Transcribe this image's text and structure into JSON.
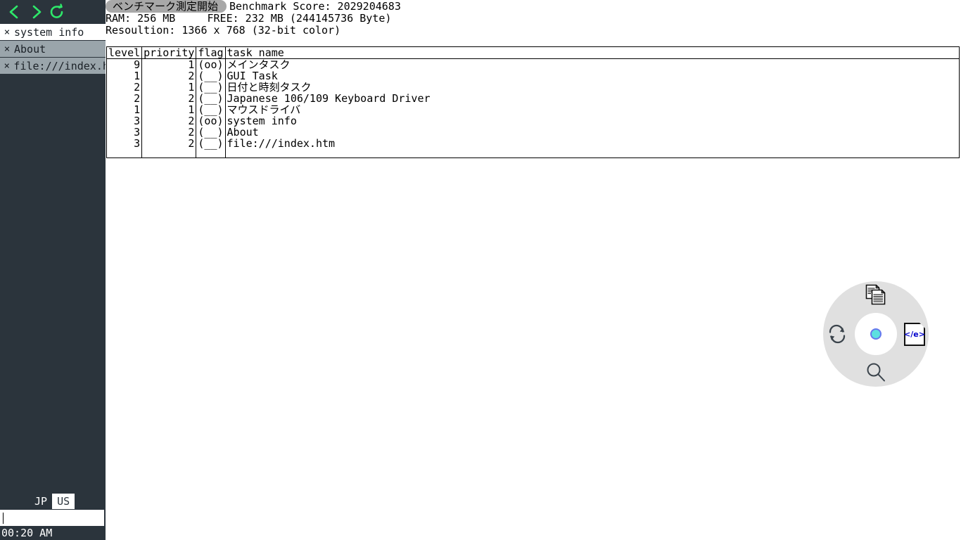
{
  "sidebar": {
    "nav": [
      {
        "name": "back-icon",
        "label": "<"
      },
      {
        "name": "forward-icon",
        "label": ">"
      },
      {
        "name": "reload-icon",
        "label": "↺"
      }
    ],
    "tasks": [
      {
        "close": "×",
        "label": "system info",
        "active": true
      },
      {
        "close": "×",
        "label": "About",
        "active": false
      },
      {
        "close": "×",
        "label": "file:///index.h",
        "active": false
      }
    ],
    "keyboard": {
      "options": [
        "JP",
        "US"
      ],
      "selected": "JP"
    },
    "command_input": {
      "value": "",
      "placeholder": ""
    },
    "clock": "00:20 AM"
  },
  "sysinfo": {
    "benchmark_button": "ベンチマーク測定開始",
    "benchmark_score": "Benchmark Score: 2029204683",
    "memory_line": "RAM: 256 MB     FREE: 232 MB (244145736 Byte)",
    "resolution_line": "Resoultion: 1366 x 768 (32-bit color)",
    "table": {
      "headers": [
        "level",
        "priority",
        "flag",
        "task name"
      ],
      "rows": [
        {
          "level": "9",
          "priority": "1",
          "flag": "(oo)",
          "name": "メインタスク"
        },
        {
          "level": "1",
          "priority": "2",
          "flag": "(__)",
          "name": "GUI Task"
        },
        {
          "level": "2",
          "priority": "1",
          "flag": "(__)",
          "name": "日付と時刻タスク"
        },
        {
          "level": "2",
          "priority": "2",
          "flag": "(__)",
          "name": "Japanese 106/109 Keyboard Driver"
        },
        {
          "level": "1",
          "priority": "1",
          "flag": "(__)",
          "name": "マウスドライバ"
        },
        {
          "level": "3",
          "priority": "2",
          "flag": "(oo)",
          "name": "system info"
        },
        {
          "level": "3",
          "priority": "2",
          "flag": "(__)",
          "name": "About"
        },
        {
          "level": "3",
          "priority": "2",
          "flag": "(__)",
          "name": "file:///index.htm"
        }
      ]
    }
  },
  "radial_menu": {
    "items": [
      {
        "position": "top",
        "icon": "documents-icon",
        "label": ""
      },
      {
        "position": "right",
        "icon": "html-code-file-icon",
        "label": "</e>"
      },
      {
        "position": "bottom",
        "icon": "search-magnifier-icon",
        "label": ""
      },
      {
        "position": "left",
        "icon": "refresh-sync-icon",
        "label": ""
      }
    ],
    "center": {
      "icon": "center-dot",
      "label": ""
    }
  },
  "colors": {
    "sidebar_bg": "#2b343c",
    "nav_icon": "#2ee86a",
    "task_active_bg": "#ffffff",
    "task_inactive_bg": "#9aa5ab",
    "radial_ring": "#e0e0e0",
    "center_dot": "#5ce0e0",
    "center_ring": "#6677ee",
    "code_text": "#0000cc",
    "bench_button_bg": "#a8a8a8"
  }
}
